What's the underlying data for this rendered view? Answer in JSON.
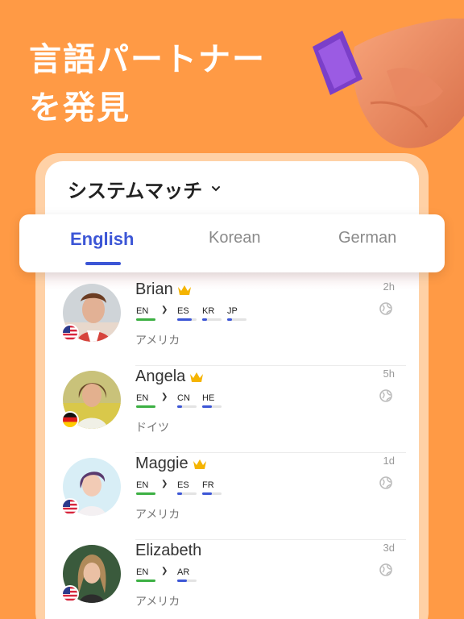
{
  "hero": {
    "line1": "言語パートナー",
    "line2": "を発見"
  },
  "panel": {
    "title": "システムマッチ"
  },
  "tabs": [
    {
      "label": "English",
      "active": true
    },
    {
      "label": "Korean",
      "active": false
    },
    {
      "label": "German",
      "active": false
    }
  ],
  "colors": {
    "background": "#FF9A45",
    "accent": "#3C56D6",
    "native_bar": "#3CB043",
    "crown": "#F5B400"
  },
  "users": [
    {
      "name": "Brian",
      "vip": true,
      "time": "2h",
      "country": "アメリカ",
      "flag": "us",
      "native": "EN",
      "learning": [
        {
          "code": "ES",
          "level": 0.75
        },
        {
          "code": "KR",
          "level": 0.25
        },
        {
          "code": "JP",
          "level": 0.25
        }
      ]
    },
    {
      "name": "Angela",
      "vip": true,
      "time": "5h",
      "country": "ドイツ",
      "flag": "de",
      "native": "EN",
      "learning": [
        {
          "code": "CN",
          "level": 0.25
        },
        {
          "code": "HE",
          "level": 0.5
        }
      ]
    },
    {
      "name": "Maggie",
      "vip": true,
      "time": "1d",
      "country": "アメリカ",
      "flag": "us",
      "native": "EN",
      "learning": [
        {
          "code": "ES",
          "level": 0.25
        },
        {
          "code": "FR",
          "level": 0.5
        }
      ]
    },
    {
      "name": "Elizabeth",
      "vip": false,
      "time": "3d",
      "country": "アメリカ",
      "flag": "us",
      "native": "EN",
      "learning": [
        {
          "code": "AR",
          "level": 0.5
        }
      ]
    }
  ]
}
